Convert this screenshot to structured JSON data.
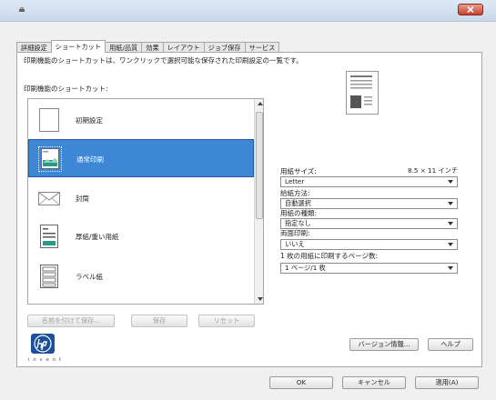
{
  "tabs": [
    "詳細設定",
    "ショートカット",
    "用紙/品質",
    "効果",
    "レイアウト",
    "ジョブ保存",
    "サービス"
  ],
  "description": "印刷機能のショートカットは、ワンクリックで選択可能な保存された印刷設定の一覧です。",
  "shortcut_heading": "印刷機能のショートカット:",
  "shortcuts": [
    {
      "label": "初期設定",
      "icon": "blank-page-icon"
    },
    {
      "label": "通常印刷",
      "icon": "landscape-photo-icon"
    },
    {
      "label": "封筒",
      "icon": "envelope-icon"
    },
    {
      "label": "厚紙/重い用紙",
      "icon": "document-icon"
    },
    {
      "label": "ラベル紙",
      "icon": "label-sheet-icon"
    }
  ],
  "list_buttons": {
    "save_as": "名前を付けて保存...",
    "save": "保存",
    "delete": "リセット"
  },
  "fields": {
    "paper_size_label": "用紙サイズ:",
    "paper_size_value": "8.5 × 11 インチ",
    "paper_size_select": "Letter",
    "paper_source_label": "給紙方法:",
    "paper_source_select": "自動選択",
    "paper_type_label": "用紙の種類:",
    "paper_type_select": "指定なし",
    "duplex_label": "両面印刷:",
    "duplex_select": "いいえ",
    "pages_per_sheet_label": "1 枚の用紙に印刷するページ数:",
    "pages_per_sheet_select": "1 ページ/1 枚"
  },
  "buttons": {
    "about": "バージョン情報...",
    "help": "ヘルプ",
    "ok": "OK",
    "cancel": "キャンセル",
    "apply": "適用(A)"
  },
  "brand": {
    "tagline": "i n v e n t"
  },
  "colors": {
    "selection": "#3d87d5",
    "close": "#c7402b",
    "hp_blue": "#1c4f9c"
  }
}
